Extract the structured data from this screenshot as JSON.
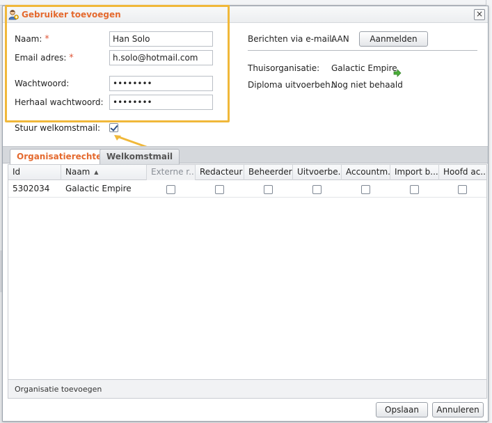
{
  "dialog": {
    "title": "Gebruiker toevoegen",
    "close_label": "×"
  },
  "form": {
    "name_label": "Naam:",
    "name_value": "Han Solo",
    "email_label": "Email adres:",
    "email_value": "h.solo@hotmail.com",
    "required_marker": "*",
    "password_label": "Wachtwoord:",
    "password_value": "secret12",
    "repeat_password_label": "Herhaal wachtwoord:",
    "repeat_password_value": "secret12",
    "welcome_mail_label": "Stuur welkomstmail:",
    "welcome_mail_checked": true
  },
  "info": {
    "email_messages_label": "Berichten via e-mail:",
    "email_messages_value": "AAN",
    "subscribe_button": "Aanmelden",
    "home_org_label": "Thuisorganisatie:",
    "home_org_value": "Galactic Empire",
    "diploma_label": "Diploma uitvoerbeh.:",
    "diploma_value": "Nog niet behaald"
  },
  "tabs": [
    {
      "label": "Organisatierechten",
      "active": true
    },
    {
      "label": "Welkomstmail",
      "active": false
    }
  ],
  "grid": {
    "columns": [
      "Id",
      "Naam",
      "Externe r...",
      "Redacteur",
      "Beheerder",
      "Uitvoerbe...",
      "Accountm...",
      "Import b...",
      "Hoofd ac..."
    ],
    "sorted_column": "Naam",
    "rows": [
      {
        "id": "5302034",
        "name": "Galactic Empire",
        "checks": [
          false,
          false,
          false,
          false,
          false,
          false,
          false
        ]
      }
    ]
  },
  "footer": {
    "add_org_label": "Organisatie toevoegen",
    "save_button": "Opslaan",
    "cancel_button": "Annuleren"
  },
  "colors": {
    "accent": "#e46a2f",
    "highlight": "#f0b83a"
  },
  "icons": {
    "title": "user-add-icon",
    "home_org": "arrow-right-icon",
    "sort": "sort-asc-icon"
  }
}
